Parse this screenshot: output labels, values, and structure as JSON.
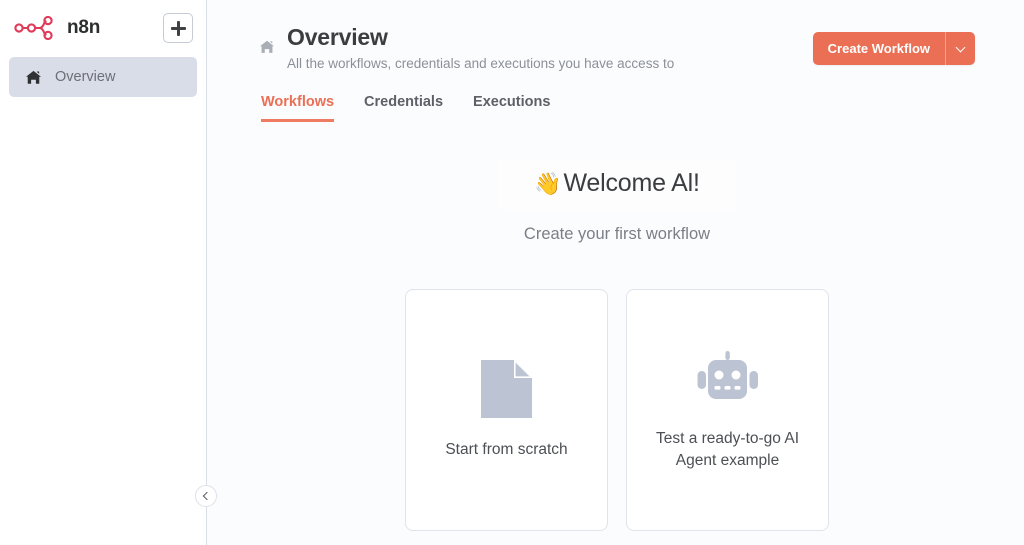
{
  "sidebar": {
    "brand": {
      "name": "n8n",
      "logo_icon": "n8n-node-logo",
      "logo_color": "#e03b58"
    },
    "add_button": {
      "icon": "plus-icon",
      "label": "+"
    },
    "items": [
      {
        "id": "overview",
        "label": "Overview",
        "icon": "home-icon",
        "active": true
      }
    ],
    "collapse_button": {
      "icon": "chevron-left-icon"
    }
  },
  "header": {
    "icon": "home-icon",
    "title": "Overview",
    "subtitle": "All the workflows, credentials and executions you have access to",
    "primary_action": {
      "label": "Create Workflow",
      "color": "#ea6f54",
      "caret_icon": "chevron-down-icon"
    }
  },
  "tabs": [
    {
      "id": "workflows",
      "label": "Workflows",
      "active": true
    },
    {
      "id": "credentials",
      "label": "Credentials",
      "active": false
    },
    {
      "id": "executions",
      "label": "Executions",
      "active": false
    }
  ],
  "welcome": {
    "emoji": "👋",
    "title": "Welcome Al!",
    "subtitle": "Create your first workflow"
  },
  "cards": [
    {
      "id": "start-from-scratch",
      "icon": "document-icon",
      "label": "Start from scratch"
    },
    {
      "id": "ai-agent-example",
      "icon": "robot-icon",
      "label": "Test a ready-to-go AI Agent example"
    }
  ],
  "colors": {
    "accent": "#ea6f54",
    "brand": "#e03b58",
    "page_background": "#fbfcfe",
    "sidebar_background": "#ffffff",
    "active_item_background": "#d9dde7",
    "icon_muted": "#b8bfcf"
  }
}
